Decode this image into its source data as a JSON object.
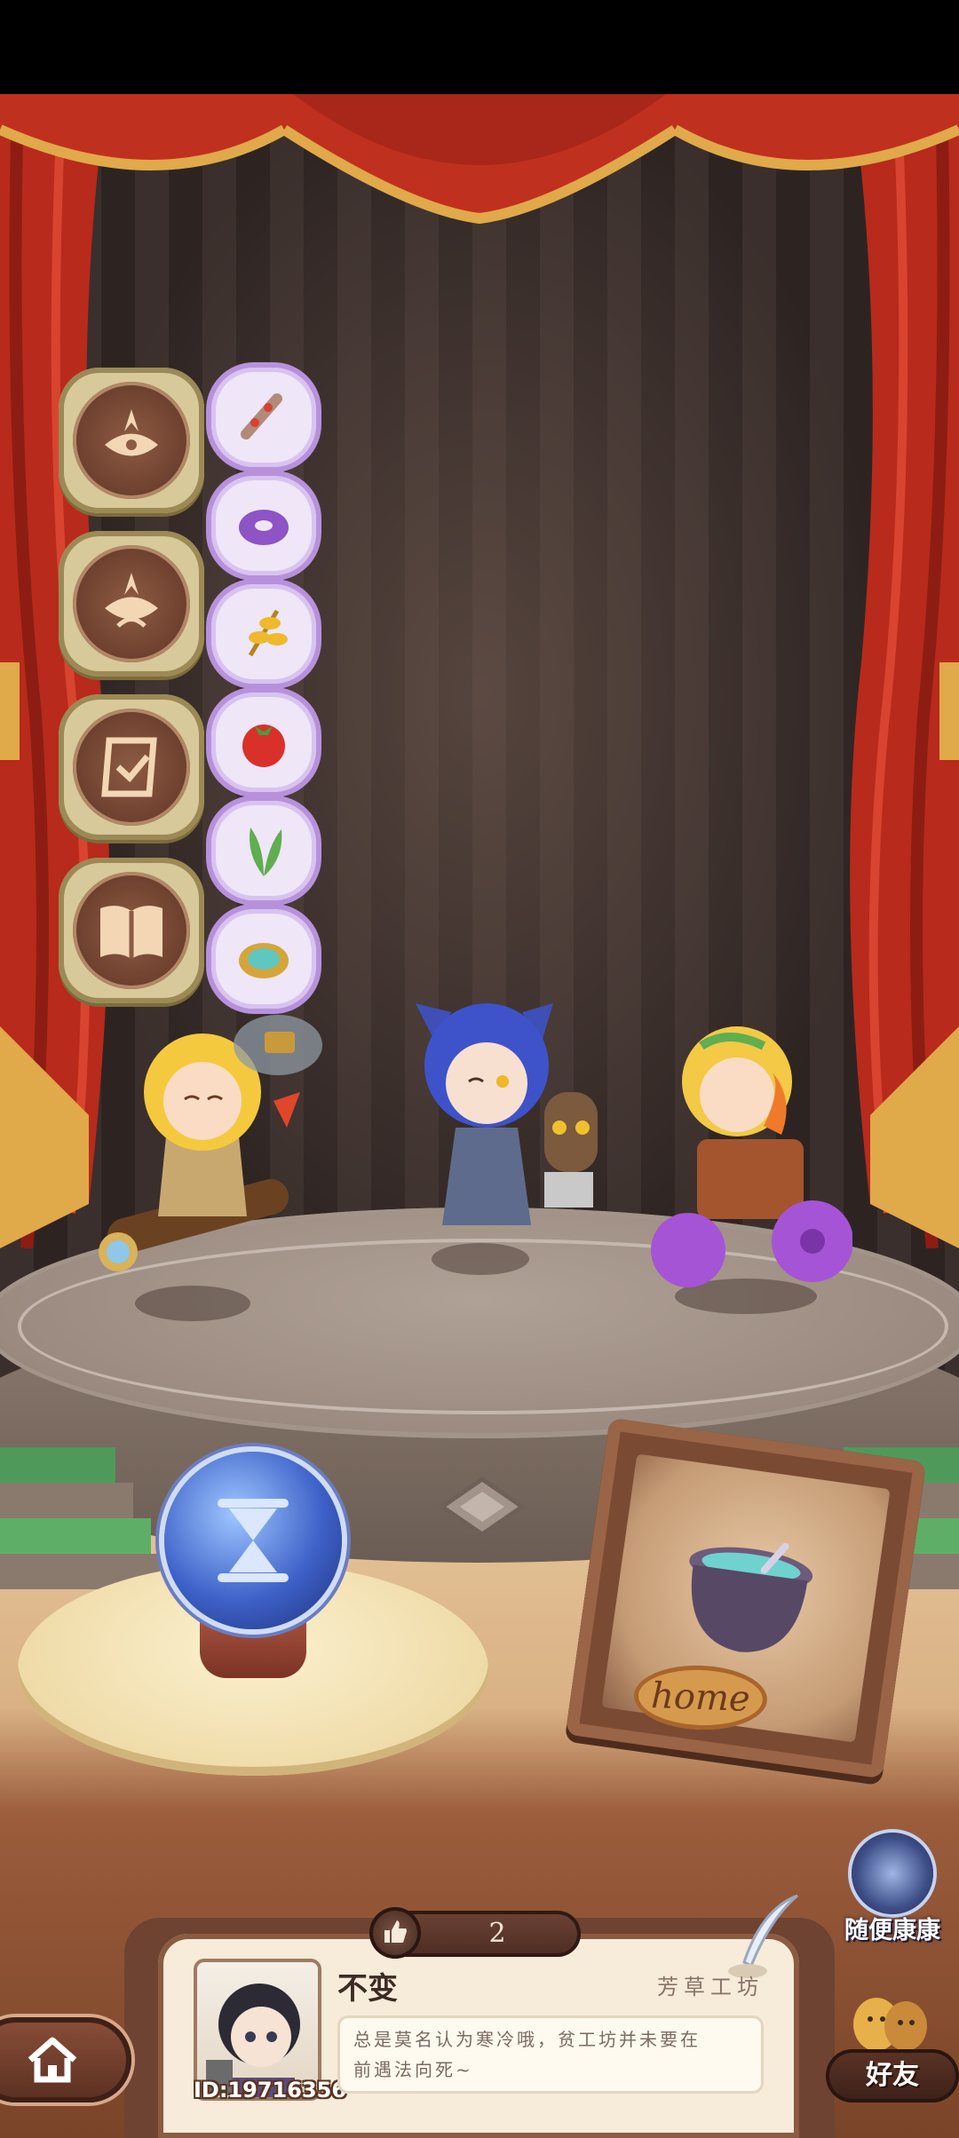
{
  "player": {
    "name": "不变",
    "id": "ID:19716356",
    "workshop": "芳草工坊",
    "bio_line1": "总是莫名认为寒冷哦，贫工坊并未要在",
    "bio_line2": "前遇法向死~"
  },
  "likes": {
    "count": "2"
  },
  "buttons": {
    "random_visit": "随便康康",
    "friends": "好友",
    "home_plaque": "home"
  },
  "left_badges": [
    "ornament-badge-icon",
    "ornament-badge-icon",
    "quest-scroll-badge-icon",
    "book-badge-icon"
  ],
  "items": [
    "ginseng-root-icon",
    "purple-donut-icon",
    "golden-wheat-icon",
    "tomato-icon",
    "leafy-greens-icon",
    "compass-charm-icon"
  ],
  "colors": {
    "curtain": "#c0301f",
    "curtain_gold": "#e0a94a",
    "orb_blue": "#3e62c9",
    "card_bg": "#f7ecd9",
    "item_cloud": "#b791dc"
  }
}
